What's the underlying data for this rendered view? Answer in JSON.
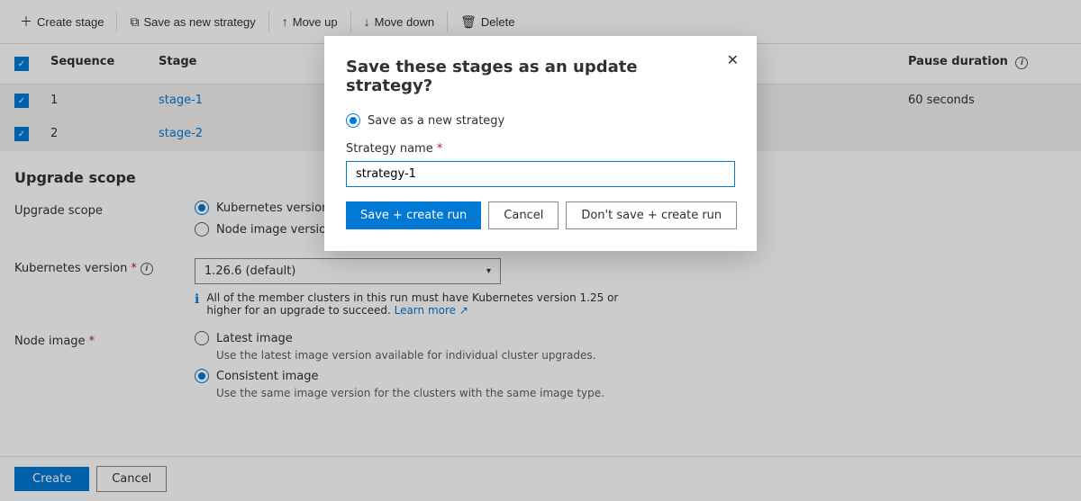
{
  "toolbar": {
    "create_stage_label": "Create stage",
    "save_strategy_label": "Save as new strategy",
    "move_up_label": "Move up",
    "move_down_label": "Move down",
    "delete_label": "Delete"
  },
  "table": {
    "columns": [
      "Sequence",
      "Stage",
      "Pause duration"
    ],
    "rows": [
      {
        "sequence": "1",
        "stage": "stage-1",
        "pause": "60 seconds"
      },
      {
        "sequence": "2",
        "stage": "stage-2",
        "pause": ""
      }
    ]
  },
  "upgrade_scope": {
    "section_title": "Upgrade scope",
    "label": "Upgrade scope",
    "options": [
      {
        "label": "Kubernetes version (including node image version)",
        "selected": true
      },
      {
        "label": "Node image version only",
        "selected": false
      }
    ]
  },
  "kubernetes_version": {
    "label": "Kubernetes version",
    "required": "*",
    "selected": "1.26.6 (default)",
    "info": "All of the member clusters in this run must have Kubernetes version 1.25 or higher for an upgrade to succeed.",
    "learn_more": "Learn more"
  },
  "node_image": {
    "label": "Node image",
    "required": "*",
    "options": [
      {
        "label": "Latest image",
        "sublabel": "Use the latest image version available for individual cluster upgrades.",
        "selected": false
      },
      {
        "label": "Consistent image",
        "sublabel": "Use the same image version for the clusters with the same image type.",
        "selected": true
      }
    ]
  },
  "bottom": {
    "create_label": "Create",
    "cancel_label": "Cancel"
  },
  "modal": {
    "title": "Save these stages as an update strategy?",
    "radio_label": "Save as a new strategy",
    "strategy_name_label": "Strategy name",
    "required_star": "*",
    "input_value": "strategy-1",
    "input_placeholder": "strategy-1",
    "save_run_label": "Save + create run",
    "cancel_label": "Cancel",
    "dont_save_label": "Don't save + create run"
  }
}
